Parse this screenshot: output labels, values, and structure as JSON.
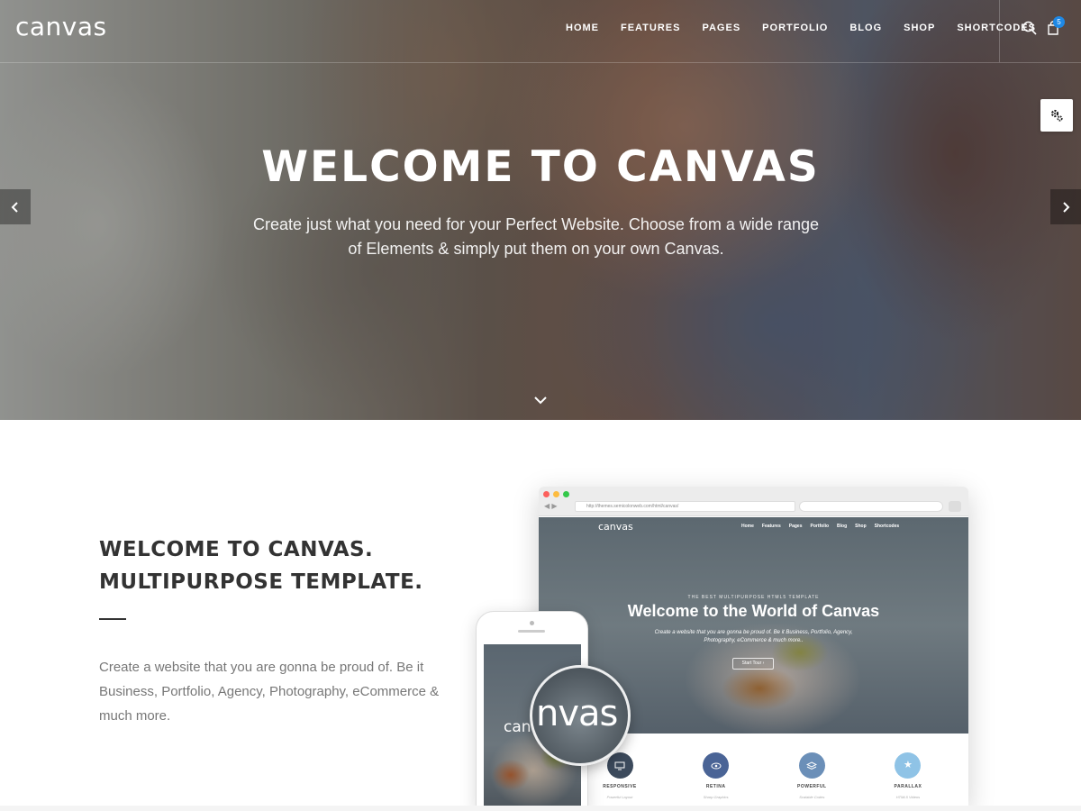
{
  "header": {
    "logo": "canvas",
    "nav": [
      "HOME",
      "FEATURES",
      "PAGES",
      "PORTFOLIO",
      "BLOG",
      "SHOP",
      "SHORTCODES"
    ],
    "cart_count": "5",
    "icons": [
      "search-icon",
      "cart-icon",
      "gear-icon"
    ]
  },
  "hero": {
    "title": "WELCOME TO CANVAS",
    "subtitle_line1": "Create just what you need for your Perfect Website. Choose from a wide range",
    "subtitle_line2": "of Elements & simply put them on your own Canvas.",
    "icons": [
      "chevron-left-icon",
      "chevron-right-icon",
      "chevron-down-icon"
    ]
  },
  "intro": {
    "title_line1": "WELCOME TO CANVAS.",
    "title_line2": "MULTIPURPOSE TEMPLATE.",
    "text": "Create a website that you are gonna be proud of. Be it Business, Portfolio, Agency, Photography, eCommerce & much more."
  },
  "mockup": {
    "url": "http://themes.semicolonweb.com/html/canvas/",
    "logo": "canvas",
    "nav": [
      "Home",
      "Features",
      "Pages",
      "Portfolio",
      "Blog",
      "Shop",
      "Shortcodes"
    ],
    "tagline": "THE BEST MULTIPURPOSE HTML5 TEMPLATE",
    "title": "Welcome to the World of Canvas",
    "subtitle": "Create a website that you are gonna be proud of. Be it Business, Portfolio, Agency, Photography, eCommerce & much more..",
    "button": "Start Tour ›",
    "features": [
      {
        "label": "RESPONSIVE",
        "desc": "Powerful Layout",
        "color": "#3c4a5c",
        "icon": "monitor-icon"
      },
      {
        "label": "RETINA",
        "desc": "Sharp Graphics",
        "color": "#4a6496",
        "icon": "eye-icon"
      },
      {
        "label": "POWERFUL",
        "desc": "Scalable Codes",
        "color": "#6b8fb8",
        "icon": "layers-icon"
      },
      {
        "label": "PARALLAX",
        "desc": "HTML5 Videos",
        "color": "#8fc3e6",
        "icon": "star-icon"
      }
    ],
    "phone_logo": "canvas",
    "lens_text": "nvas"
  }
}
